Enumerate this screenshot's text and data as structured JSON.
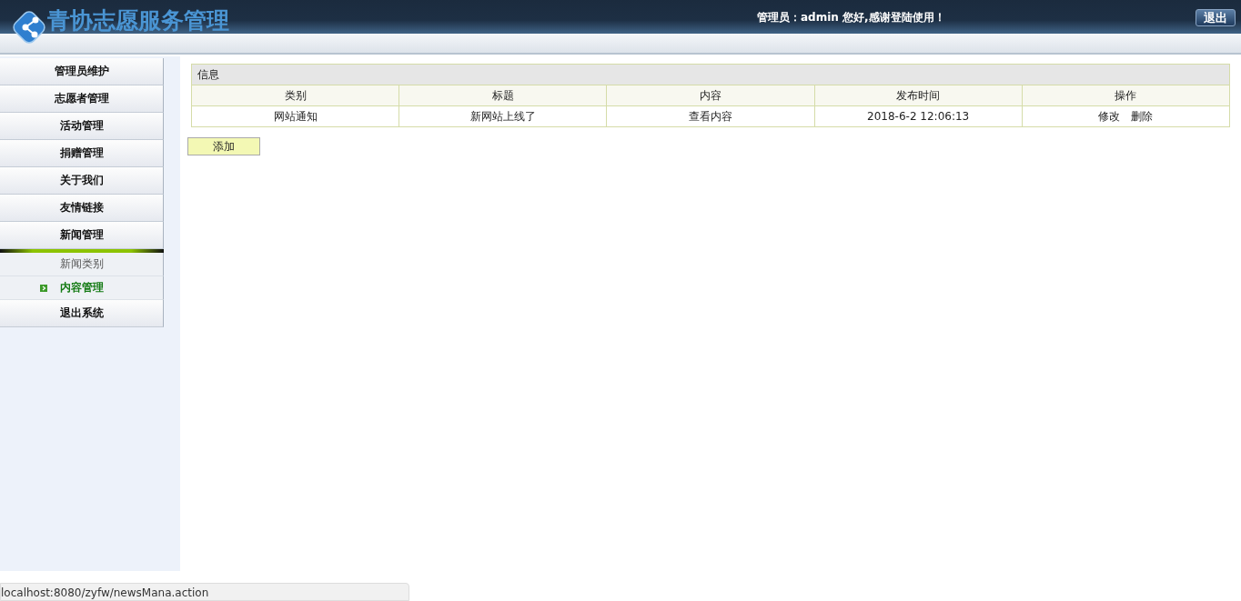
{
  "header": {
    "title": "青协志愿服务管理",
    "greeting": "管理员：admin 您好,感谢登陆使用！",
    "logout_button": "退出"
  },
  "sidebar": {
    "items": [
      {
        "label": "管理员维护"
      },
      {
        "label": "志愿者管理"
      },
      {
        "label": "活动管理"
      },
      {
        "label": "捐赠管理"
      },
      {
        "label": "关于我们"
      },
      {
        "label": "友情链接"
      },
      {
        "label": "新闻管理",
        "children": [
          {
            "label": "新闻类别",
            "selected": false
          },
          {
            "label": "内容管理",
            "selected": true
          }
        ]
      },
      {
        "label": "退出系统"
      }
    ]
  },
  "table": {
    "caption": "信息",
    "columns": [
      "类别",
      "标题",
      "内容",
      "发布时间",
      "操作"
    ],
    "rows": [
      {
        "category": "网站通知",
        "title": "新网站上线了",
        "content_link": "查看内容",
        "time": "2018-6-2 12:06:13",
        "actions": [
          "修改",
          "删除"
        ]
      }
    ]
  },
  "add_button": "添加",
  "status_bar": "localhost:8080/zyfw/newsMana.action"
}
